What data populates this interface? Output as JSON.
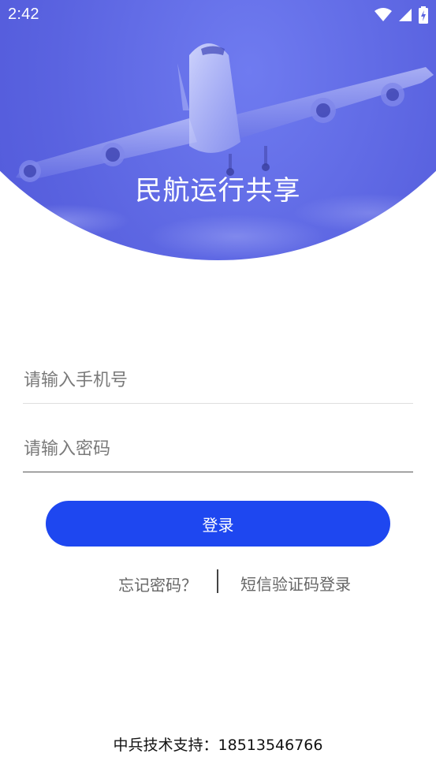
{
  "status_bar": {
    "time": "2:42",
    "icons": [
      "wifi-icon",
      "cellular-signal-icon",
      "battery-charging-icon"
    ]
  },
  "header": {
    "title": "民航运行共享"
  },
  "form": {
    "phone_placeholder": "请输入手机号",
    "password_placeholder": "请输入密码",
    "login_label": "登录"
  },
  "links": {
    "forgot_password": "忘记密码？",
    "sms_login": "短信验证码登录"
  },
  "footer": {
    "support_label": "中兵技术支持：",
    "support_phone": "18513546766"
  },
  "colors": {
    "hero": "#5a63e0",
    "primary_button": "#1e47f0",
    "link_text": "#666666"
  }
}
